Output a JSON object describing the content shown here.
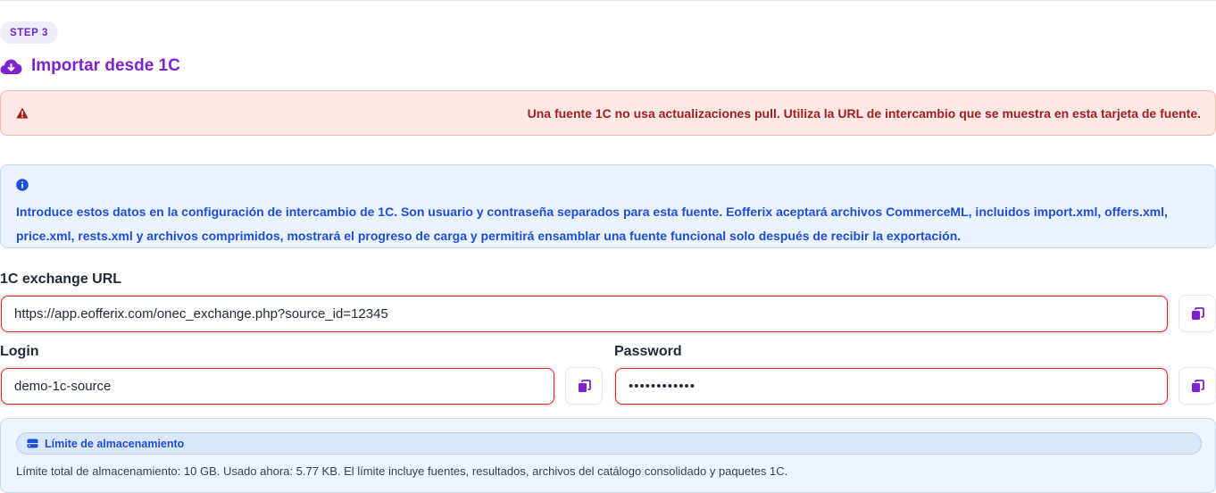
{
  "step": {
    "label": "STEP 3"
  },
  "header": {
    "title": "Importar desde 1C",
    "icon": "cloud-download-icon"
  },
  "warning": {
    "icon": "warning-triangle-icon",
    "text": "Una fuente 1C no usa actualizaciones pull. Utiliza la URL de intercambio que se muestra en esta tarjeta de fuente."
  },
  "info": {
    "icon": "info-circle-icon",
    "line1": "Introduce estos datos en la configuración de intercambio de 1C. Son usuario y contraseña separados para esta fuente. Eofferix aceptará archivos CommerceML, incluidos import.xml, offers.xml,",
    "line2": "price.xml, rests.xml y archivos comprimidos, mostrará el progreso de carga y permitirá ensamblar una fuente funcional solo después de recibir la exportación."
  },
  "form": {
    "url_label": "1C exchange URL",
    "url_value": "https://app.eofferix.com/onec_exchange.php?source_id=12345",
    "login_label": "Login",
    "login_value": "demo-1c-source",
    "password_label": "Password",
    "password_value": "••••••••••••",
    "copy_icon": "copy-icon"
  },
  "storage": {
    "icon": "storage-icon",
    "title": "Límite de almacenamiento",
    "text": "Límite total de almacenamiento: 10 GB. Usado ahora: 5.77 KB. El límite incluye fuentes, resultados, archivos del catálogo consolidado y paquetes 1C."
  },
  "colors": {
    "accent": "#7e22ce",
    "error": "#dc2626",
    "info": "#1d4ed8"
  }
}
